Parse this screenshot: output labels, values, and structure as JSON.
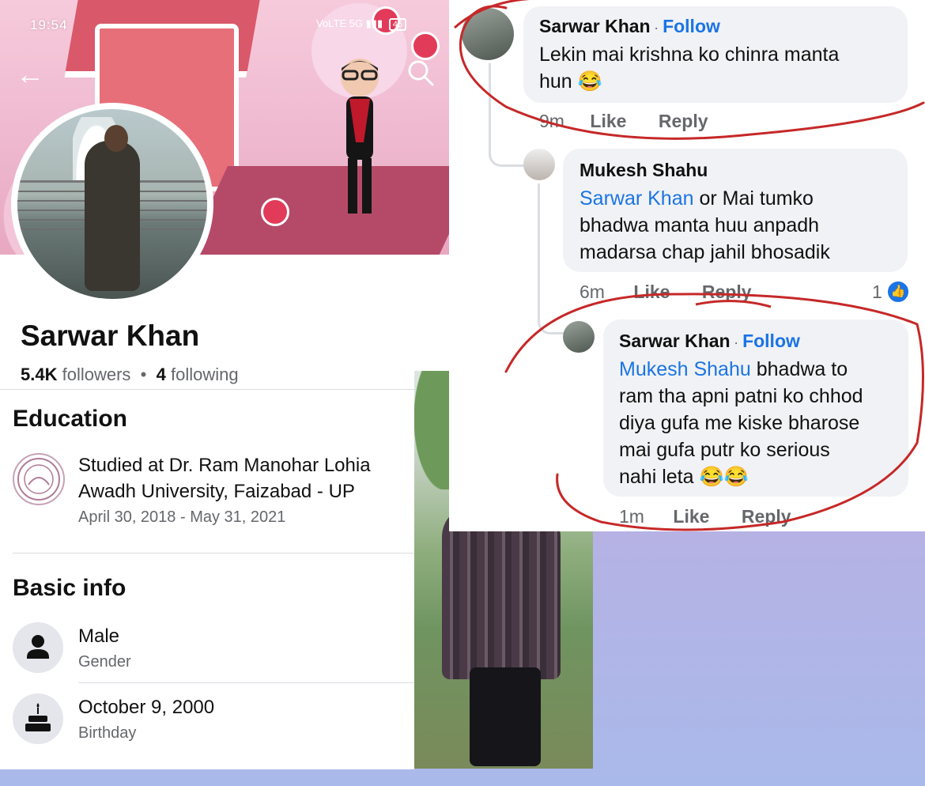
{
  "status_bar": {
    "time": "19:54",
    "network_label": "VoLTE 5G",
    "battery": "45"
  },
  "profile": {
    "name": "Sarwar Khan",
    "followers_count": "5.4K",
    "followers_label": "followers",
    "following_count": "4",
    "following_label": "following"
  },
  "education": {
    "title": "Education",
    "school_line1": "Studied at Dr. Ram Manohar Lohia",
    "school_line2": "Awadh University, Faizabad - UP",
    "dates": "April 30, 2018 - May 31, 2021"
  },
  "basic_info": {
    "title": "Basic info",
    "gender_value": "Male",
    "gender_label": "Gender",
    "birthday_value": "October 9, 2000",
    "birthday_label": "Birthday"
  },
  "comments": [
    {
      "author": "Sarwar Khan",
      "follow": "Follow",
      "text_line1": "Lekin mai krishna ko chinra manta",
      "text_line2": "hun 😂",
      "time": "9m",
      "like": "Like",
      "reply": "Reply"
    },
    {
      "author": "Mukesh Shahu",
      "mention": "Sarwar Khan",
      "text_line1": " or Mai tumko",
      "text_line2": "bhadwa manta huu anpadh",
      "text_line3": "madarsa chap jahil bhosadik",
      "time": "6m",
      "like": "Like",
      "reply": "Reply",
      "reaction_count": "1"
    },
    {
      "author": "Sarwar Khan",
      "follow": "Follow",
      "mention": "Mukesh Shahu",
      "text_line1": " bhadwa to",
      "text_line2": "ram tha apni patni ko chhod",
      "text_line3": "diya gufa me kiske bharose",
      "text_line4": "mai gufa putr ko serious",
      "text_line5": "nahi leta 😂😂",
      "time": "1m",
      "like": "Like",
      "reply": "Reply"
    }
  ],
  "colors": {
    "facebook_blue": "#1b74e4",
    "annotation_red": "#c62828",
    "background_gradient_top": "#c8b6e6",
    "background_gradient_bottom": "#a9b9ea"
  }
}
